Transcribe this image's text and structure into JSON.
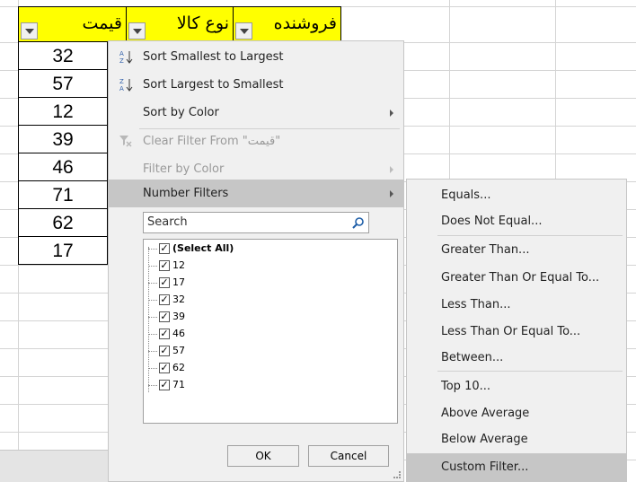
{
  "sheet": {
    "headers": {
      "price": "قيمت",
      "product_type": "نوع كالا",
      "seller": "فروشنده"
    },
    "price_values": [
      "32",
      "57",
      "12",
      "39",
      "46",
      "71",
      "62",
      "17"
    ]
  },
  "filter_menu": {
    "sort_asc": "Sort Smallest to Largest",
    "sort_desc": "Sort Largest to Smallest",
    "sort_color": "Sort by Color",
    "clear_filter": "Clear Filter From \"قيمت\"",
    "filter_color": "Filter by Color",
    "number_filters": "Number Filters",
    "search_placeholder": "Search",
    "checklist": [
      "(Select All)",
      "12",
      "17",
      "32",
      "39",
      "46",
      "57",
      "62",
      "71"
    ],
    "ok": "OK",
    "cancel": "Cancel"
  },
  "number_filters_submenu": {
    "items": [
      "Equals...",
      "Does Not Equal...",
      "Greater Than...",
      "Greater Than Or Equal To...",
      "Less Than...",
      "Less Than Or Equal To...",
      "Between...",
      "Top 10...",
      "Above Average",
      "Below Average",
      "Custom Filter..."
    ],
    "highlighted": "Custom Filter..."
  },
  "icons": {
    "sort_asc": "sort-ascending-az-icon",
    "sort_desc": "sort-descending-za-icon",
    "clear_filter": "clear-filter-funnel-icon",
    "search": "magnifier-icon",
    "dropdown": "filter-dropdown-arrow-icon"
  },
  "colors": {
    "header_fill": "#ffff00",
    "menu_bg": "#f0f0f0",
    "highlight": "#c6c6c6"
  }
}
